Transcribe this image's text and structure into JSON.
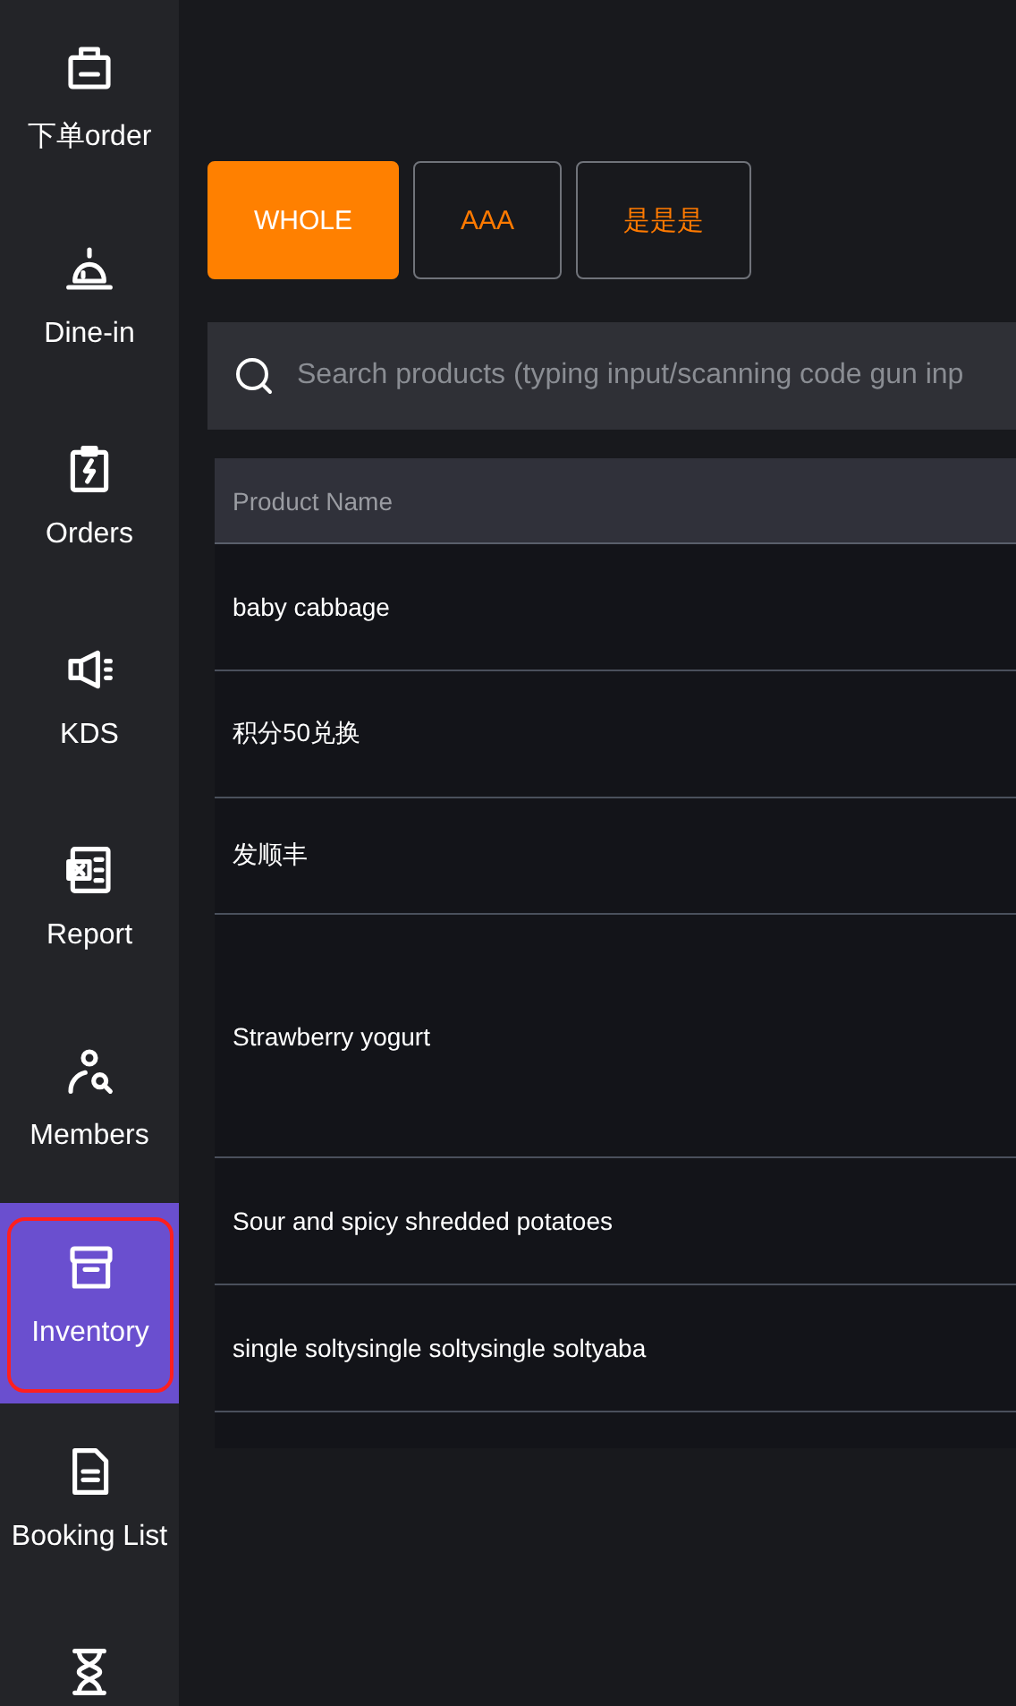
{
  "sidebar": {
    "items": [
      {
        "label": "下单order",
        "selected": false
      },
      {
        "label": "Dine-in",
        "selected": false
      },
      {
        "label": "Orders",
        "selected": false
      },
      {
        "label": "KDS",
        "selected": false
      },
      {
        "label": "Report",
        "selected": false
      },
      {
        "label": "Members",
        "selected": false
      },
      {
        "label": "Inventory",
        "selected": true
      },
      {
        "label": "Booking List",
        "selected": false
      },
      {
        "selected": false
      }
    ]
  },
  "category_tabs": [
    {
      "label": "WHOLE",
      "selected": true
    },
    {
      "label": "AAA",
      "selected": false
    },
    {
      "label": "是是是",
      "selected": false
    }
  ],
  "search": {
    "placeholder": "Search products (typing input/scanning code gun inp"
  },
  "table": {
    "columns": [
      "Product Name"
    ],
    "rows": [
      {
        "cells": [
          "baby cabbage"
        ]
      },
      {
        "cells": [
          "积分50兑换"
        ]
      },
      {
        "cells": [
          "发顺丰"
        ]
      },
      {
        "cells": [
          "Strawberry yogurt"
        ]
      },
      {
        "cells": [
          "Sour and spicy shredded potatoes"
        ]
      },
      {
        "cells": [
          "single soltysingle soltysingle soltyaba"
        ]
      }
    ]
  }
}
